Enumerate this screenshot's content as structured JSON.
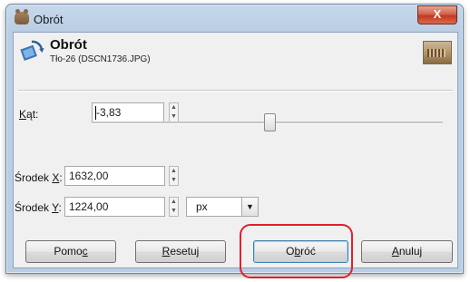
{
  "window": {
    "title": "Obrót",
    "close_label": "X"
  },
  "header": {
    "title": "Obrót",
    "subtitle": "Tło-26 (DSCN1736.JPG)"
  },
  "angle": {
    "label_u": "K",
    "label_rest": "ąt:",
    "value": "-3,83"
  },
  "center_x": {
    "label_pre": "Środek ",
    "label_u": "X",
    "label_post": ":",
    "value": "1632,00"
  },
  "center_y": {
    "label_pre": "Środek ",
    "label_u": "Y",
    "label_post": ":",
    "value": "1224,00"
  },
  "unit": {
    "value": "px"
  },
  "buttons": {
    "help_pre": "Pomo",
    "help_u": "c",
    "reset_u": "R",
    "reset_rest": "esetuj",
    "rotate_pre": "O",
    "rotate_u": "b",
    "rotate_rest": "róć",
    "cancel_u": "A",
    "cancel_rest": "nuluj"
  },
  "colors": {
    "highlight": "#e0202c",
    "titlebar": "#b9cde4"
  }
}
